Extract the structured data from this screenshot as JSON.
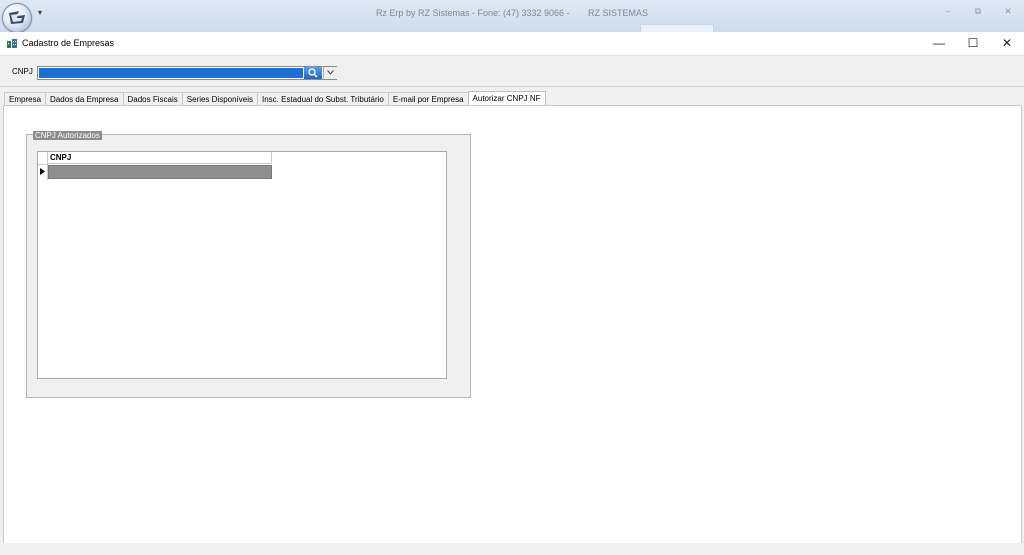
{
  "app": {
    "title": "Rz Erp by RZ Sistemas - Fone: (47) 3332 9066 -",
    "company": "RZ SISTEMAS",
    "qat_glyph": "▾",
    "controls": {
      "minimize": "–",
      "restore": "⧉",
      "close": "✕"
    }
  },
  "window": {
    "title": "Cadastro de Empresas",
    "controls": {
      "minimize": "—",
      "maximize": "☐",
      "close": "✕"
    }
  },
  "toolbar": {
    "cnpj_label": "CNPJ",
    "cnpj_value": ""
  },
  "tabs": [
    {
      "label": "Empresa",
      "active": false
    },
    {
      "label": "Dados da Empresa",
      "active": false
    },
    {
      "label": "Dados Fiscais",
      "active": false
    },
    {
      "label": "Series Disponíveis",
      "active": false
    },
    {
      "label": "Insc. Estadual do Subst. Tributário",
      "active": false
    },
    {
      "label": "E-mail por Empresa",
      "active": false
    },
    {
      "label": "Autorizar CNPJ NF",
      "active": true
    }
  ],
  "group": {
    "legend": "CNPJ Autorizados",
    "grid": {
      "columns": [
        "CNPJ"
      ],
      "rows": [
        [
          ""
        ]
      ]
    }
  },
  "colors": {
    "selection": "#1c6fd6",
    "selected_row": "#8f8f8f"
  }
}
